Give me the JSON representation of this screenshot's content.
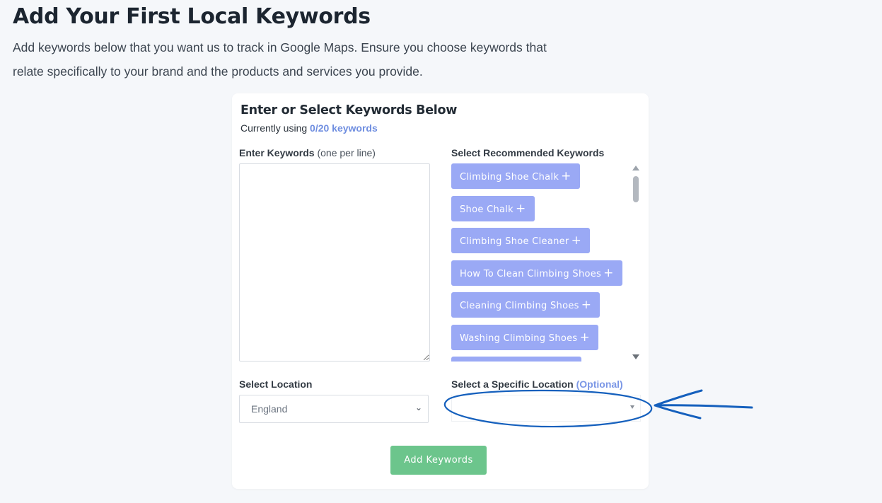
{
  "page": {
    "title": "Add Your First Local Keywords",
    "description": "Add keywords below that you want us to track in Google Maps. Ensure you choose keywords that relate specifically to your brand and the products and services you provide."
  },
  "card": {
    "title": "Enter or Select Keywords Below",
    "usage_prefix": "Currently using",
    "usage_value": "0/20 keywords"
  },
  "enter_keywords": {
    "label": "Enter Keywords",
    "hint": "(one per line)",
    "value": ""
  },
  "recommended": {
    "label": "Select Recommended Keywords",
    "chips": [
      {
        "label": "Climbing Shoe Chalk"
      },
      {
        "label": "Shoe Chalk"
      },
      {
        "label": "Climbing Shoe Cleaner"
      },
      {
        "label": "How To Clean Climbing Shoes"
      },
      {
        "label": "Cleaning Climbing Shoes"
      },
      {
        "label": "Washing Climbing Shoes"
      },
      {
        "label": ""
      }
    ],
    "chip_icon": "plus-icon"
  },
  "location": {
    "label": "Select Location",
    "selected": "England"
  },
  "specific_location": {
    "label": "Select a Specific Location",
    "optional": "(Optional)",
    "selected": ""
  },
  "actions": {
    "add_label": "Add Keywords"
  },
  "annotation": {
    "type": "hand-drawn circle with arrow",
    "color": "#1560bd"
  }
}
